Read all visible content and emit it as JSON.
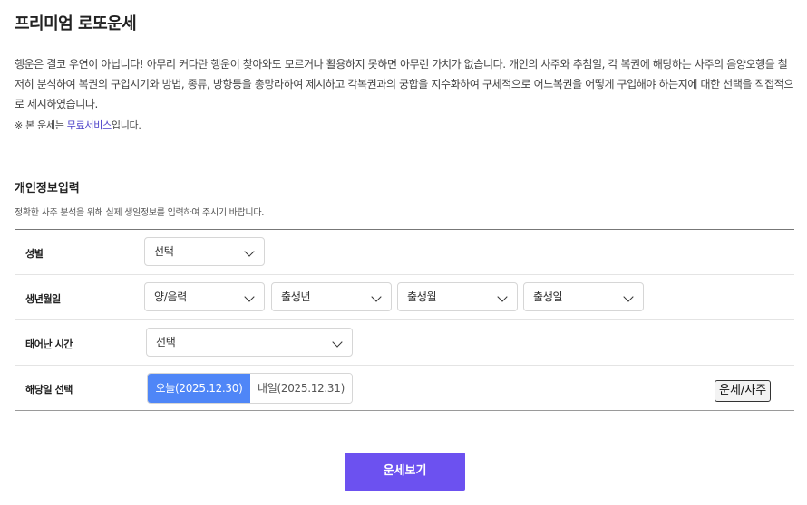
{
  "page": {
    "title": "프리미엄 로또운세",
    "intro": "행운은 결코 우연이 아닙니다! 아무리 커다란 행운이 찾아와도 모르거나 활용하지 못하면 아무런 가치가 없습니다. 개인의 사주와 추첨일, 각 복권에 해당하는 사주의 음양오행을 철저히 분석하여 복권의 구입시기와 방법, 종류, 방향등을 총망라하여 제시하고 각복권과의 궁합을 지수화하여 구체적으로 어느복권을 어떻게 구입해야 하는지에 대한 선택을 직접적으로 제시하였습니다.",
    "note_prefix": "※ 본 운세는 ",
    "note_link": "무료서비스",
    "note_suffix": "입니다."
  },
  "section": {
    "title": "개인정보입력",
    "desc": "정확한 사주 분석을 위해 실제 생일정보를 입력하여 주시기 바랍니다."
  },
  "form": {
    "gender": {
      "label": "성별",
      "value": "선택"
    },
    "birth": {
      "label": "생년월일",
      "calendar": "양/음력",
      "year": "출생년",
      "month": "출생월",
      "day": "출생일"
    },
    "time": {
      "label": "태어난 시간",
      "value": "선택"
    },
    "date": {
      "label": "해당일 선택",
      "today": "오늘(2025.12.30)",
      "tomorrow": "내일(2025.12.31)",
      "side_button": "운세/사주"
    }
  },
  "submit": {
    "label": "운세보기"
  },
  "colors": {
    "accent": "#6c51f0",
    "segment_active": "#4f86f7",
    "link": "#4a3fc8"
  }
}
